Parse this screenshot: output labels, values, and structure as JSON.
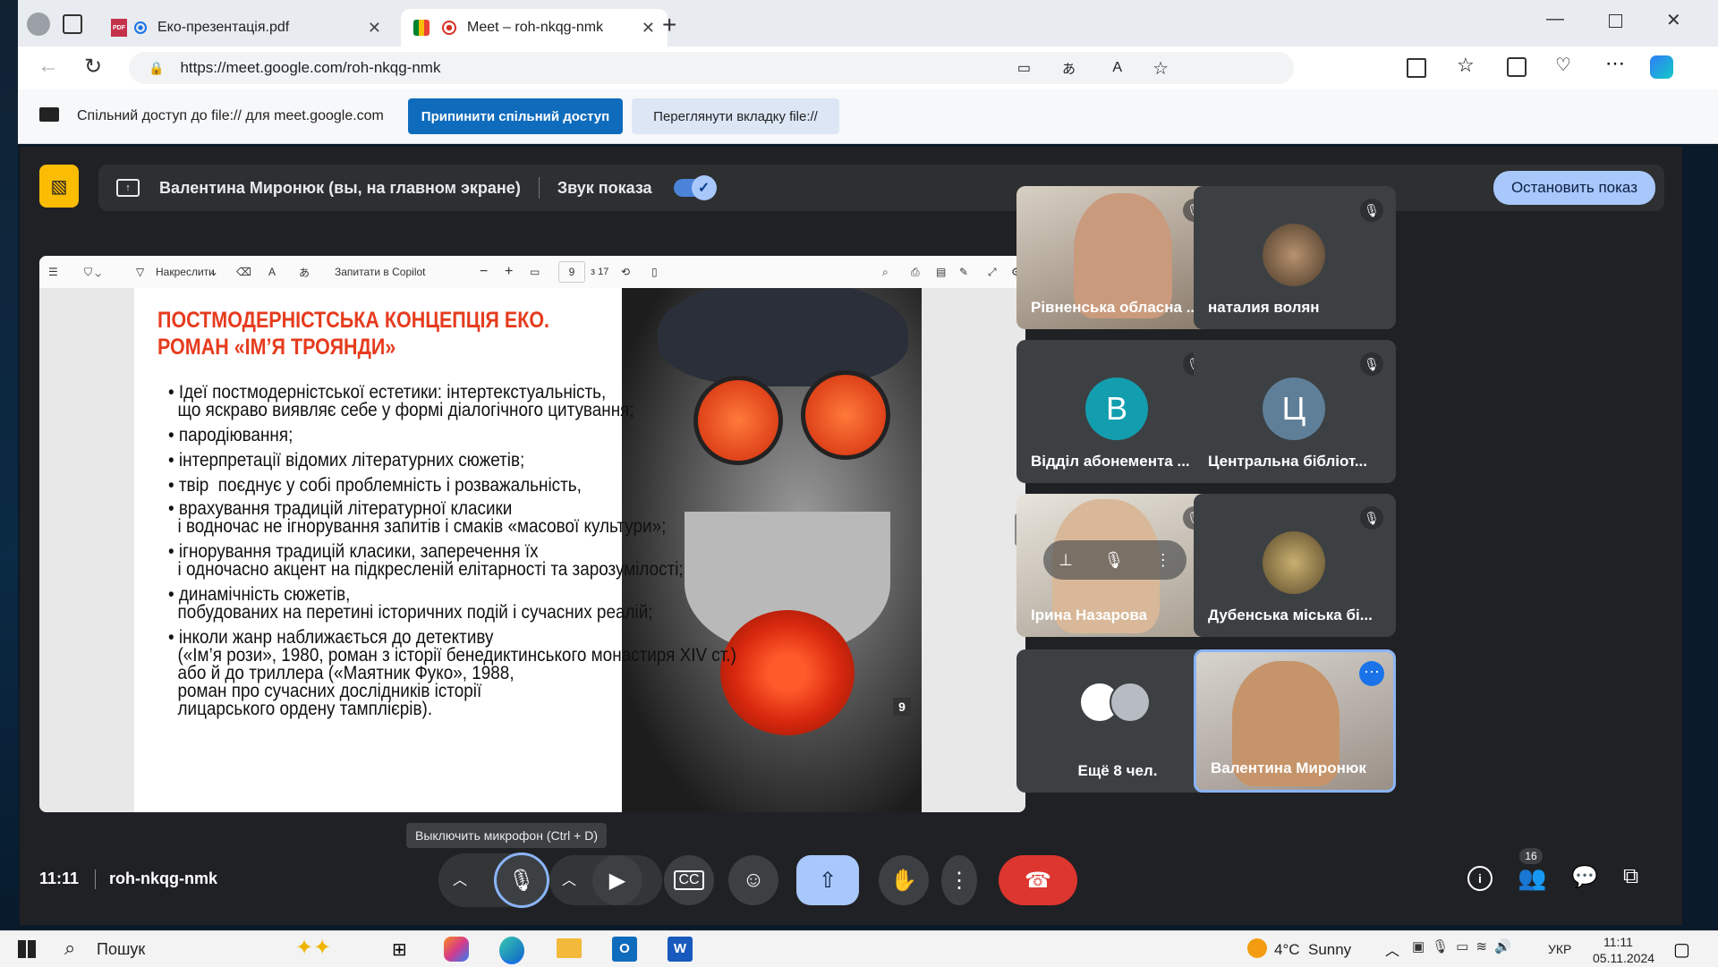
{
  "browser": {
    "tabs": [
      {
        "label": "Еко-презентація.pdf",
        "fav_badge": "PDF"
      },
      {
        "label": "Meet – roh-nkqg-nmk"
      }
    ],
    "url": "https://meet.google.com/roh-nkqg-nmk"
  },
  "share_bar": {
    "text": "Спільний доступ до file:// для meet.google.com",
    "stop_label": "Припинити спільний доступ",
    "view_label": "Переглянути вкладку file://"
  },
  "presenter_bar": {
    "text": "Валентина Миронюк (вы, на главном экране)",
    "sound_label": "Звук показа",
    "stop_label": "Остановить показ"
  },
  "pdf_toolbar": {
    "draw_label": "Накреслити",
    "copilot_label": "Запитати в Copilot",
    "page": "9",
    "page_total": "з 17"
  },
  "slide": {
    "title1": "ПОСТМОДЕРНІСТСЬКА КОНЦЕПЦІЯ ЕКО.",
    "title2": "РОМАН «ІМ’Я ТРОЯНДИ»",
    "lines": [
      "• Ідеї постмодерністської естетики: інтертекстуальність,",
      "  що яскраво виявляє себе у формі діалогічного цитування;",
      "• пародіювання;",
      "• інтерпретації відомих літературних сюжетів;",
      "• твір  поєднує у собі проблемність і розважальність,",
      "• врахування традицій літературної класики",
      "  і водночас не ігнорування запитів і смаків «масової культури»;",
      "• ігнорування традицій класики, заперечення їх",
      "  і одночасно акцент на підкресленій елітарності та зарозумілості;",
      "• динамічність сюжетів,",
      "  побудованих на перетині історичних подій і сучасних реалій;",
      "• інколи жанр наближається до детективу",
      "  («Ім’я рози», 1980, роман з історії бенедиктинського монастиря XIV ст.)",
      "  або й до триллера («Маятник Фуко», 1988,",
      "  роман про сучасних дослідників історії",
      "  лицарського ордену тамплієрів)."
    ],
    "page_badge": "9"
  },
  "participants": [
    {
      "name": "Рівненська обласна ..."
    },
    {
      "name": "наталия волян"
    },
    {
      "name": "Відділ абонемента ...",
      "initial": "В",
      "color": "#129eaf"
    },
    {
      "name": "Центральна бібліот...",
      "initial": "Ц",
      "color": "#5f7f99"
    },
    {
      "name": "Ірина Назарова"
    },
    {
      "name": "Дубенська міська бі..."
    },
    {
      "name": "Ещё 8 чел."
    },
    {
      "name": "Валентина Миронюк"
    }
  ],
  "meeting": {
    "time": "11:11",
    "code": "roh-nkqg-nmk",
    "mic_tooltip": "Выключить микрофон (Ctrl + D)",
    "people_count": "16"
  },
  "taskbar": {
    "search": "Пошук",
    "weather": "4°C  Sunny",
    "lang": "УКР",
    "clock_time": "11:11",
    "clock_date": "05.11.2024"
  }
}
